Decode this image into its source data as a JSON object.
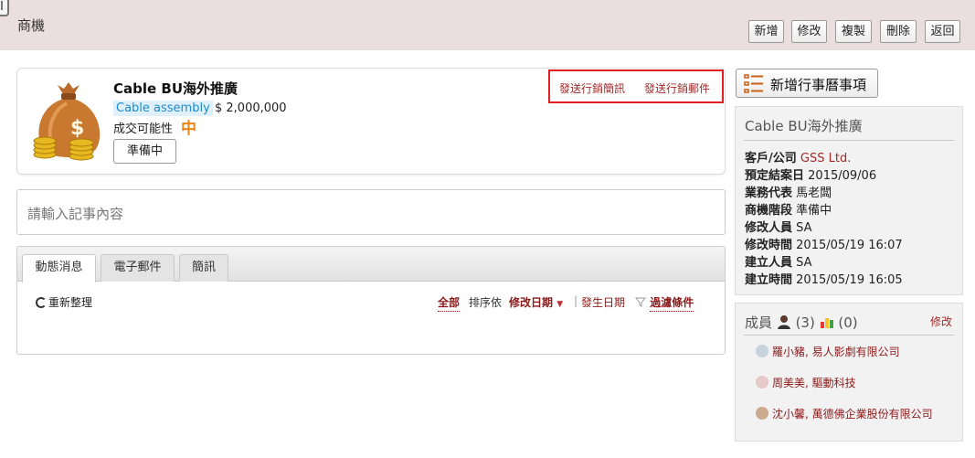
{
  "header": {
    "title": "商機",
    "buttons": {
      "add": "新增",
      "edit": "修改",
      "copy": "複製",
      "delete": "刪除",
      "back": "返回"
    }
  },
  "opportunity": {
    "title": "Cable BU海外推廣",
    "product": "Cable assembly",
    "amount": "$ 2,000,000",
    "probability_label": "成交可能性",
    "probability_value": "中",
    "stage_button": "準備中",
    "actions": {
      "send_sms": "發送行銷簡訊",
      "send_email": "發送行銷郵件"
    }
  },
  "note": {
    "placeholder": "請輸入記事內容"
  },
  "feed": {
    "tabs": [
      "動態消息",
      "電子郵件",
      "簡訊"
    ],
    "refresh": "重新整理",
    "filter_all": "全部",
    "sort_by": "排序依",
    "sort_modified": "修改日期",
    "separator": "|",
    "sort_occurred": "發生日期",
    "filter_conditions": "過濾條件"
  },
  "sidebar": {
    "add_event": "新增行事曆事項",
    "detail": {
      "title": "Cable BU海外推廣",
      "fields": [
        {
          "label": "客戶/公司",
          "value": "GSS Ltd."
        },
        {
          "label": "預定結案日",
          "value": "2015/09/06"
        },
        {
          "label": "業務代表",
          "value": "馬老闆"
        },
        {
          "label": "商機階段",
          "value": "準備中"
        },
        {
          "label": "修改人員",
          "value": "SA"
        },
        {
          "label": "修改時間",
          "value": "2015/05/19 16:07"
        },
        {
          "label": "建立人員",
          "value": "SA"
        },
        {
          "label": "建立時間",
          "value": "2015/05/19 16:05"
        }
      ]
    },
    "members": {
      "title": "成員",
      "person_count": "(3)",
      "group_count": "(0)",
      "edit": "修改",
      "list": [
        "羅小豬, 易人影劇有限公司",
        "周美美, 驅動科技",
        "沈小馨, 萬德佛企業股份有限公司"
      ]
    }
  },
  "colors": {
    "header_bg": "#eadede",
    "accent_red": "#a02a2a",
    "highlight_border": "#e02020",
    "probability": "#e8861a",
    "product_tag_bg": "#dff0fb"
  }
}
